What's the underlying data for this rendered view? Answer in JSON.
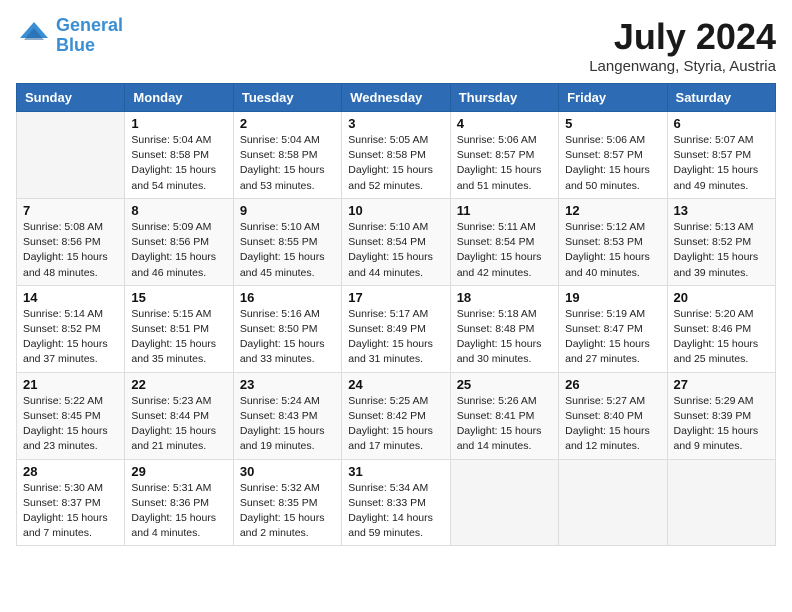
{
  "header": {
    "logo_line1": "General",
    "logo_line2": "Blue",
    "month_title": "July 2024",
    "location": "Langenwang, Styria, Austria"
  },
  "days_of_week": [
    "Sunday",
    "Monday",
    "Tuesday",
    "Wednesday",
    "Thursday",
    "Friday",
    "Saturday"
  ],
  "weeks": [
    [
      {
        "num": "",
        "info": ""
      },
      {
        "num": "1",
        "info": "Sunrise: 5:04 AM\nSunset: 8:58 PM\nDaylight: 15 hours\nand 54 minutes."
      },
      {
        "num": "2",
        "info": "Sunrise: 5:04 AM\nSunset: 8:58 PM\nDaylight: 15 hours\nand 53 minutes."
      },
      {
        "num": "3",
        "info": "Sunrise: 5:05 AM\nSunset: 8:58 PM\nDaylight: 15 hours\nand 52 minutes."
      },
      {
        "num": "4",
        "info": "Sunrise: 5:06 AM\nSunset: 8:57 PM\nDaylight: 15 hours\nand 51 minutes."
      },
      {
        "num": "5",
        "info": "Sunrise: 5:06 AM\nSunset: 8:57 PM\nDaylight: 15 hours\nand 50 minutes."
      },
      {
        "num": "6",
        "info": "Sunrise: 5:07 AM\nSunset: 8:57 PM\nDaylight: 15 hours\nand 49 minutes."
      }
    ],
    [
      {
        "num": "7",
        "info": "Sunrise: 5:08 AM\nSunset: 8:56 PM\nDaylight: 15 hours\nand 48 minutes."
      },
      {
        "num": "8",
        "info": "Sunrise: 5:09 AM\nSunset: 8:56 PM\nDaylight: 15 hours\nand 46 minutes."
      },
      {
        "num": "9",
        "info": "Sunrise: 5:10 AM\nSunset: 8:55 PM\nDaylight: 15 hours\nand 45 minutes."
      },
      {
        "num": "10",
        "info": "Sunrise: 5:10 AM\nSunset: 8:54 PM\nDaylight: 15 hours\nand 44 minutes."
      },
      {
        "num": "11",
        "info": "Sunrise: 5:11 AM\nSunset: 8:54 PM\nDaylight: 15 hours\nand 42 minutes."
      },
      {
        "num": "12",
        "info": "Sunrise: 5:12 AM\nSunset: 8:53 PM\nDaylight: 15 hours\nand 40 minutes."
      },
      {
        "num": "13",
        "info": "Sunrise: 5:13 AM\nSunset: 8:52 PM\nDaylight: 15 hours\nand 39 minutes."
      }
    ],
    [
      {
        "num": "14",
        "info": "Sunrise: 5:14 AM\nSunset: 8:52 PM\nDaylight: 15 hours\nand 37 minutes."
      },
      {
        "num": "15",
        "info": "Sunrise: 5:15 AM\nSunset: 8:51 PM\nDaylight: 15 hours\nand 35 minutes."
      },
      {
        "num": "16",
        "info": "Sunrise: 5:16 AM\nSunset: 8:50 PM\nDaylight: 15 hours\nand 33 minutes."
      },
      {
        "num": "17",
        "info": "Sunrise: 5:17 AM\nSunset: 8:49 PM\nDaylight: 15 hours\nand 31 minutes."
      },
      {
        "num": "18",
        "info": "Sunrise: 5:18 AM\nSunset: 8:48 PM\nDaylight: 15 hours\nand 30 minutes."
      },
      {
        "num": "19",
        "info": "Sunrise: 5:19 AM\nSunset: 8:47 PM\nDaylight: 15 hours\nand 27 minutes."
      },
      {
        "num": "20",
        "info": "Sunrise: 5:20 AM\nSunset: 8:46 PM\nDaylight: 15 hours\nand 25 minutes."
      }
    ],
    [
      {
        "num": "21",
        "info": "Sunrise: 5:22 AM\nSunset: 8:45 PM\nDaylight: 15 hours\nand 23 minutes."
      },
      {
        "num": "22",
        "info": "Sunrise: 5:23 AM\nSunset: 8:44 PM\nDaylight: 15 hours\nand 21 minutes."
      },
      {
        "num": "23",
        "info": "Sunrise: 5:24 AM\nSunset: 8:43 PM\nDaylight: 15 hours\nand 19 minutes."
      },
      {
        "num": "24",
        "info": "Sunrise: 5:25 AM\nSunset: 8:42 PM\nDaylight: 15 hours\nand 17 minutes."
      },
      {
        "num": "25",
        "info": "Sunrise: 5:26 AM\nSunset: 8:41 PM\nDaylight: 15 hours\nand 14 minutes."
      },
      {
        "num": "26",
        "info": "Sunrise: 5:27 AM\nSunset: 8:40 PM\nDaylight: 15 hours\nand 12 minutes."
      },
      {
        "num": "27",
        "info": "Sunrise: 5:29 AM\nSunset: 8:39 PM\nDaylight: 15 hours\nand 9 minutes."
      }
    ],
    [
      {
        "num": "28",
        "info": "Sunrise: 5:30 AM\nSunset: 8:37 PM\nDaylight: 15 hours\nand 7 minutes."
      },
      {
        "num": "29",
        "info": "Sunrise: 5:31 AM\nSunset: 8:36 PM\nDaylight: 15 hours\nand 4 minutes."
      },
      {
        "num": "30",
        "info": "Sunrise: 5:32 AM\nSunset: 8:35 PM\nDaylight: 15 hours\nand 2 minutes."
      },
      {
        "num": "31",
        "info": "Sunrise: 5:34 AM\nSunset: 8:33 PM\nDaylight: 14 hours\nand 59 minutes."
      },
      {
        "num": "",
        "info": ""
      },
      {
        "num": "",
        "info": ""
      },
      {
        "num": "",
        "info": ""
      }
    ]
  ]
}
